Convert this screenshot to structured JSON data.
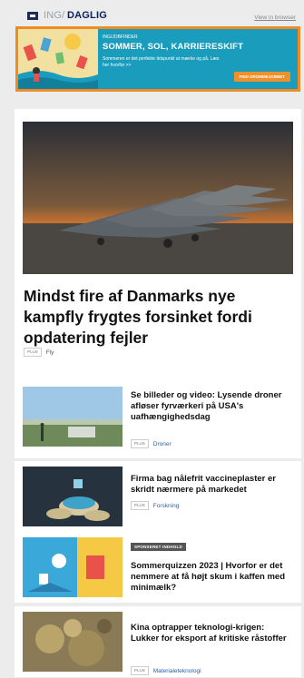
{
  "header": {
    "brand_prefix": "ING/",
    "brand_name": "DAGLIG",
    "view_in_browser": "View in browser"
  },
  "banner": {
    "eyebrow": "ING/JOBFINDER",
    "headline": "SOMMER, SOL, KARRIERESKIFT",
    "subline": "Sommeren er det perfekte tidspunkt at mærke og på. Læs her hvorfor >>",
    "button": "FIND DROMMEJOBBET",
    "colors": {
      "background": "#1a9dbd",
      "border": "#f08a24",
      "button": "#f0902b"
    }
  },
  "hero": {
    "title": "Mindst fire af Danmarks nye kampfly frygtes forsinket fordi opdatering fejler",
    "tag": "PLUS",
    "category": "Fly"
  },
  "articles": [
    {
      "title": "Se billeder og video: Lysende droner afløser fyrværkeri på USA's uafhængighedsdag",
      "tag": "PLUS",
      "category": "Droner"
    },
    {
      "title": "Firma bag nålefrit vaccineplaster er skridt nærmere på markedet",
      "tag": "PLUS",
      "category": "Forskning"
    },
    {
      "sponsor_label": "SPONSERET INDHOLD",
      "title": "Sommerquizzen 2023 | Hvorfor er det nemmere at få højt skum i kaffen med minimælk?"
    },
    {
      "title": "Kina optrapper teknologi-krigen: Lukker for eksport af kritiske råstoffer",
      "tag": "PLUS",
      "category": "Materialeteknologi"
    }
  ]
}
